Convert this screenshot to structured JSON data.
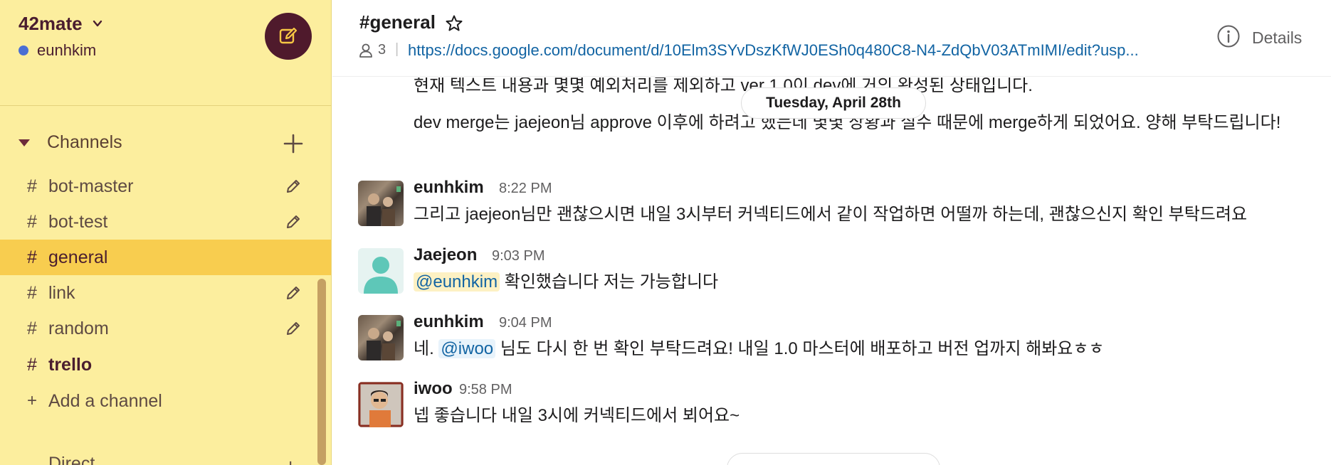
{
  "colors": {
    "sidebar_bg": "#fcee9e",
    "sidebar_active": "#f8cd4f",
    "compose_bg": "#4f1a2c",
    "link": "#1264a3",
    "mention_bg": "#fdf1c3"
  },
  "workspace": {
    "name": "42mate",
    "user": "eunhkim",
    "compose_icon": "compose-icon"
  },
  "sidebar": {
    "section_label": "Channels",
    "channels": [
      {
        "label": "bot-master"
      },
      {
        "label": "bot-test"
      },
      {
        "label": "general"
      },
      {
        "label": "link"
      },
      {
        "label": "random"
      },
      {
        "label": "trello"
      }
    ],
    "add_channel_label": "Add a channel",
    "next_section_peek": "Direct"
  },
  "header": {
    "channel_title": "#general",
    "member_count": "3",
    "topic": "https://docs.google.com/document/d/10Elm3SYvDszKfWJ0ESh0q480C8-N4-ZdQbV03ATmIMI/edit?usp...",
    "details_label": "Details"
  },
  "messages": {
    "continuation_1": "현재 텍스트 내용과 몇몇 예외처리를 제외하고 ver 1.0이 dev에 거의 완성된 상태입니다.",
    "continuation_2": "dev merge는 jaejeon님 approve 이후에 하려고 했는데 몇몇 상황과 실수 때문에 merge하게 되었어요. 양해 부탁드립니다!",
    "date_divider": "Tuesday, April 28th",
    "items": [
      {
        "author": "eunhkim",
        "time": "8:22 PM",
        "text": "그리고 jaejeon님만 괜찮으시면 내일 3시부터 커넥티드에서 같이 작업하면 어떨까 하는데, 괜찮으신지 확인 부탁드려요"
      },
      {
        "author": "Jaejeon",
        "time": "9:03 PM",
        "mention": "@eunhkim",
        "text": " 확인했습니다 저는 가능합니다"
      },
      {
        "author": "eunhkim",
        "time": "9:04 PM",
        "prefix": "네. ",
        "mention": "@iwoo",
        "text": " 님도 다시 한 번 확인 부탁드려요! 내일 1.0 마스터에 배포하고 버전 업까지 해봐요ㅎㅎ"
      },
      {
        "author": "iwoo",
        "time": "9:58 PM",
        "text": "넵 좋습니다 내일 3시에 커넥티드에서 뵈어요~"
      }
    ]
  }
}
